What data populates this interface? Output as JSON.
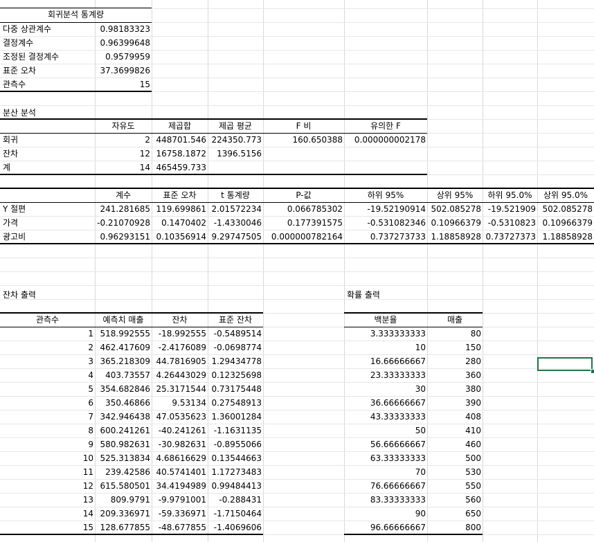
{
  "regression_stats": {
    "title": "회귀분석 통계량",
    "rows": [
      {
        "label": "다중 상관계수",
        "value": "0.98183323"
      },
      {
        "label": "결정계수",
        "value": "0.96399648"
      },
      {
        "label": "조정된 결정계수",
        "value": "0.9579959"
      },
      {
        "label": "표준 오차",
        "value": "37.3699826"
      },
      {
        "label": "관측수",
        "value": "15"
      }
    ]
  },
  "anova": {
    "title": "분산 분석",
    "headers": [
      "",
      "자유도",
      "제곱합",
      "제곱 평균",
      "F 비",
      "유의한 F"
    ],
    "rows": [
      [
        "회귀",
        "2",
        "448701.546",
        "224350.773",
        "160.650388",
        "0.000000002178"
      ],
      [
        "잔차",
        "12",
        "16758.1872",
        "1396.5156",
        "",
        ""
      ],
      [
        "계",
        "14",
        "465459.733",
        "",
        "",
        ""
      ]
    ]
  },
  "coefficients": {
    "headers": [
      "",
      "계수",
      "표준 오차",
      "t 통계량",
      "P-값",
      "하위 95%",
      "상위 95%",
      "하위 95.0%",
      "상위 95.0%"
    ],
    "rows": [
      [
        "Y 절편",
        "241.281685",
        "119.699861",
        "2.01572234",
        "0.066785302",
        "-19.52190914",
        "502.085278",
        "-19.521909",
        "502.085278"
      ],
      [
        "가격",
        "-0.21070928",
        "0.1470402",
        "-1.4330046",
        "0.177391575",
        "-0.531082346",
        "0.10966379",
        "-0.5310823",
        "0.10966379"
      ],
      [
        "광고비",
        "0.96293151",
        "0.10356914",
        "9.29747505",
        "0.000000782164",
        "0.737273733",
        "1.18858928",
        "0.73727373",
        "1.18858928"
      ]
    ]
  },
  "residual_output": {
    "title": "잔차 출력",
    "headers": [
      "관측수",
      "예측치 매출",
      "잔차",
      "표준 잔차"
    ],
    "rows": [
      [
        "1",
        "518.992555",
        "-18.992555",
        "-0.5489514"
      ],
      [
        "2",
        "462.417609",
        "-2.4176089",
        "-0.0698774"
      ],
      [
        "3",
        "365.218309",
        "44.7816905",
        "1.29434778"
      ],
      [
        "4",
        "403.73557",
        "4.26443029",
        "0.12325698"
      ],
      [
        "5",
        "354.682846",
        "25.3171544",
        "0.73175448"
      ],
      [
        "6",
        "350.46866",
        "9.53134",
        "0.27548913"
      ],
      [
        "7",
        "342.946438",
        "47.0535623",
        "1.36001284"
      ],
      [
        "8",
        "600.241261",
        "-40.241261",
        "-1.1631135"
      ],
      [
        "9",
        "580.982631",
        "-30.982631",
        "-0.8955066"
      ],
      [
        "10",
        "525.313834",
        "4.68616629",
        "0.13544663"
      ],
      [
        "11",
        "239.42586",
        "40.5741401",
        "1.17273483"
      ],
      [
        "12",
        "615.580501",
        "34.4194989",
        "0.99484413"
      ],
      [
        "13",
        "809.9791",
        "-9.9791001",
        "-0.288431"
      ],
      [
        "14",
        "209.336971",
        "-59.336971",
        "-1.7150464"
      ],
      [
        "15",
        "128.677855",
        "-48.677855",
        "-1.4069606"
      ]
    ]
  },
  "probability_output": {
    "title": "확률 출력",
    "headers": [
      "백분율",
      "매출"
    ],
    "rows": [
      [
        "3.333333333",
        "80"
      ],
      [
        "10",
        "150"
      ],
      [
        "16.66666667",
        "280"
      ],
      [
        "23.33333333",
        "360"
      ],
      [
        "30",
        "380"
      ],
      [
        "36.66666667",
        "390"
      ],
      [
        "43.33333333",
        "408"
      ],
      [
        "50",
        "410"
      ],
      [
        "56.66666667",
        "460"
      ],
      [
        "63.33333333",
        "500"
      ],
      [
        "70",
        "530"
      ],
      [
        "76.66666667",
        "550"
      ],
      [
        "83.33333333",
        "560"
      ],
      [
        "90",
        "650"
      ],
      [
        "96.66666667",
        "800"
      ]
    ]
  },
  "colors": {
    "gridline": "#d9d9d9",
    "selection": "#217346",
    "border": "#000000"
  }
}
